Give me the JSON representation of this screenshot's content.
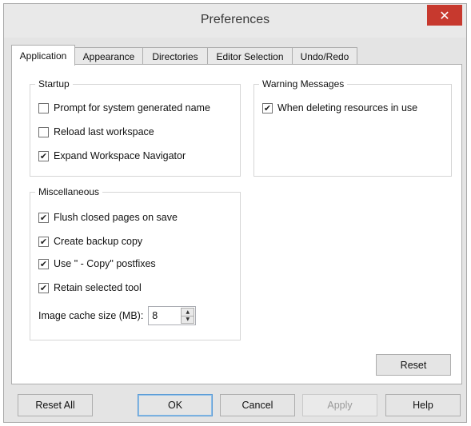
{
  "window": {
    "title": "Preferences",
    "close_glyph": "✕"
  },
  "tabs": [
    {
      "label": "Application",
      "active": true
    },
    {
      "label": "Appearance",
      "active": false
    },
    {
      "label": "Directories",
      "active": false
    },
    {
      "label": "Editor Selection",
      "active": false
    },
    {
      "label": "Undo/Redo",
      "active": false
    }
  ],
  "startup": {
    "title": "Startup",
    "items": [
      {
        "label": "Prompt for system generated name",
        "checked": false
      },
      {
        "label": "Reload last workspace",
        "checked": false
      },
      {
        "label": "Expand Workspace Navigator",
        "checked": true
      }
    ]
  },
  "warning": {
    "title": "Warning Messages",
    "items": [
      {
        "label": "When deleting resources in use",
        "checked": true
      }
    ]
  },
  "misc": {
    "title": "Miscellaneous",
    "items": [
      {
        "label": "Flush closed pages on save",
        "checked": true
      },
      {
        "label": "Create backup copy",
        "checked": true
      },
      {
        "label": "Use \" - Copy\" postfixes",
        "checked": true
      },
      {
        "label": "Retain selected tool",
        "checked": true
      }
    ],
    "cache_label": "Image cache size (MB):",
    "cache_value": "8"
  },
  "buttons": {
    "reset": "Reset",
    "reset_all": "Reset All",
    "ok": "OK",
    "cancel": "Cancel",
    "apply": "Apply",
    "help": "Help"
  },
  "glyphs": {
    "check": "✔",
    "up": "▲",
    "down": "▼"
  },
  "colors": {
    "close_bg": "#c7392e",
    "default_button_border": "#5b9bd5"
  }
}
